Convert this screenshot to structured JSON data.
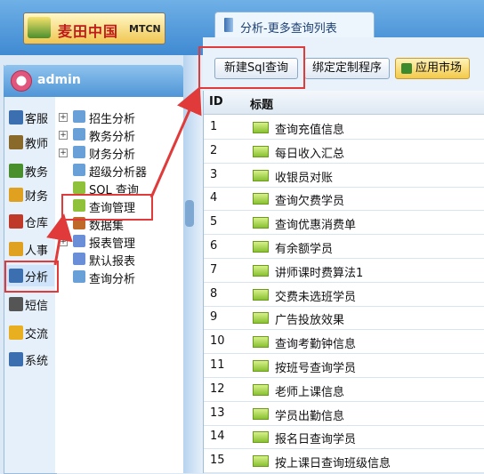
{
  "header": {
    "logo_cn": "麦田中国",
    "logo_en": "MTCN"
  },
  "tab": {
    "label": "分析-更多查询列表"
  },
  "user": {
    "name": "admin"
  },
  "sidebar": {
    "items": [
      {
        "label": "客服",
        "color": "#3b6fb0"
      },
      {
        "label": "教师",
        "color": "#8a6a2a"
      },
      {
        "label": "教务",
        "color": "#4a8f2d"
      },
      {
        "label": "财务",
        "color": "#e0a020"
      },
      {
        "label": "仓库",
        "color": "#c03a2a"
      },
      {
        "label": "人事",
        "color": "#e0a020"
      },
      {
        "label": "分析",
        "color": "#3b6fb0"
      },
      {
        "label": "短信",
        "color": "#555555"
      },
      {
        "label": "交流",
        "color": "#e8b020"
      },
      {
        "label": "系统",
        "color": "#3b6fb0"
      }
    ]
  },
  "tree": {
    "items": [
      {
        "label": "招生分析",
        "expandable": true
      },
      {
        "label": "教务分析",
        "expandable": true
      },
      {
        "label": "财务分析",
        "expandable": true
      },
      {
        "label": "超级分析器",
        "expandable": false
      },
      {
        "label": "SQL 查询",
        "expandable": false
      },
      {
        "label": "查询管理",
        "expandable": false
      },
      {
        "label": "数据集",
        "expandable": false
      },
      {
        "label": "报表管理",
        "expandable": true
      },
      {
        "label": "默认报表",
        "expandable": false
      },
      {
        "label": "查询分析",
        "expandable": false
      }
    ]
  },
  "toolbar": {
    "new_sql_label": "新建Sql查询",
    "bind_label": "绑定定制程序",
    "market_label": "应用市场"
  },
  "table": {
    "headers": {
      "id": "ID",
      "title": "标题"
    },
    "rows": [
      {
        "id": "1",
        "title": "查询充值信息"
      },
      {
        "id": "2",
        "title": "每日收入汇总"
      },
      {
        "id": "3",
        "title": "收银员对账"
      },
      {
        "id": "4",
        "title": "查询欠费学员"
      },
      {
        "id": "5",
        "title": "查询优惠消费单"
      },
      {
        "id": "6",
        "title": "有余额学员"
      },
      {
        "id": "7",
        "title": "讲师课时费算法1"
      },
      {
        "id": "8",
        "title": "交费未选班学员"
      },
      {
        "id": "9",
        "title": "广告投放效果"
      },
      {
        "id": "10",
        "title": "查询考勤钟信息"
      },
      {
        "id": "11",
        "title": "按班号查询学员"
      },
      {
        "id": "12",
        "title": "老师上课信息"
      },
      {
        "id": "13",
        "title": "学员出勤信息"
      },
      {
        "id": "14",
        "title": "报名日查询学员"
      },
      {
        "id": "15",
        "title": "按上课日查询班级信息"
      }
    ]
  },
  "colors": {
    "highlight": "#e03a3a",
    "header_blue": "#3f8ad2"
  }
}
